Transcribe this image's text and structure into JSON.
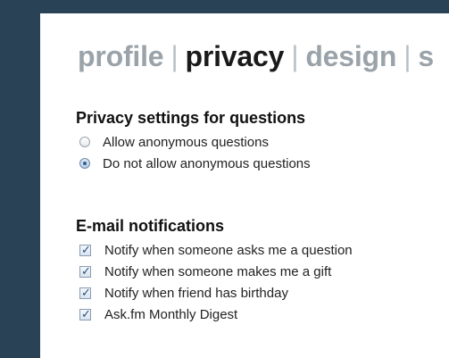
{
  "tabs": [
    {
      "label": "profile",
      "active": false
    },
    {
      "label": "privacy",
      "active": true
    },
    {
      "label": "design",
      "active": false
    },
    {
      "label": "s",
      "active": false
    }
  ],
  "tab_separator": "|",
  "privacy": {
    "title": "Privacy settings for questions",
    "options": [
      {
        "label": "Allow anonymous questions",
        "checked": false
      },
      {
        "label": "Do not allow anonymous questions",
        "checked": true
      }
    ]
  },
  "notifications": {
    "title": "E-mail notifications",
    "options": [
      {
        "label": "Notify when someone asks me a question",
        "checked": true
      },
      {
        "label": "Notify when someone makes me a gift",
        "checked": true
      },
      {
        "label": "Notify when friend has birthday",
        "checked": true
      },
      {
        "label": "Ask.fm Monthly Digest",
        "checked": true
      }
    ]
  },
  "check_glyph": "✓",
  "colors": {
    "sidebar": "#2a4256",
    "active_tab": "#1a1a1a",
    "inactive_tab": "#9aa3aa"
  }
}
